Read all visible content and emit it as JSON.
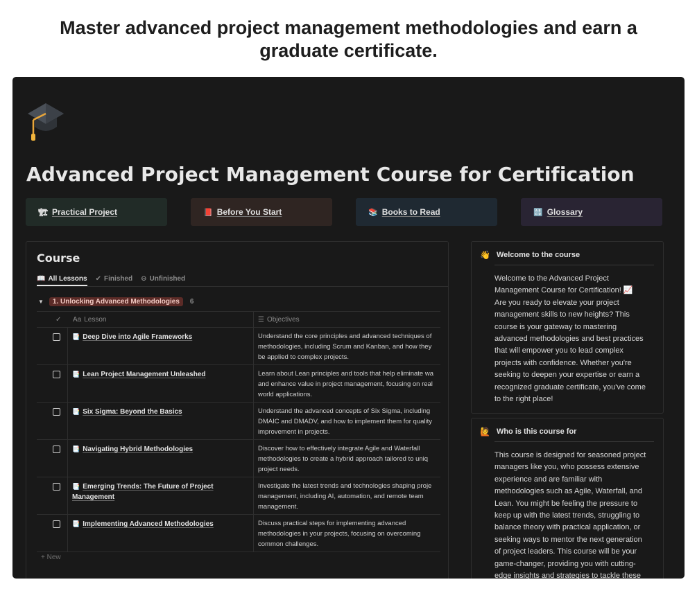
{
  "headline": {
    "line1": "Master advanced project management methodologies and earn a",
    "line2": "graduate certificate."
  },
  "page": {
    "icon": "graduation-cap-icon",
    "title": "Advanced Project Management Course for Certification"
  },
  "links": [
    {
      "icon": "🏗",
      "label": "Practical Project"
    },
    {
      "icon": "📕",
      "label": "Before You Start"
    },
    {
      "icon": "📚",
      "label": "Books to Read"
    },
    {
      "icon": "🔠",
      "label": "Glossary"
    }
  ],
  "course": {
    "title": "Course",
    "tabs": [
      {
        "icon": "📖",
        "label": "All Lessons"
      },
      {
        "icon": "✔",
        "label": "Finished"
      },
      {
        "icon": "⊖",
        "label": "Unfinished"
      }
    ],
    "group": {
      "name": "1. Unlocking Advanced Methodologies",
      "count": "6"
    },
    "columns": {
      "lesson": "Lesson",
      "lesson_icon": "Aa",
      "objectives": "Objectives"
    },
    "rows": [
      {
        "lesson": "Deep Dive into Agile Frameworks",
        "lesson2": "",
        "obj1": "Understand the core principles and advanced techniques of",
        "obj2": "methodologies, including Scrum and Kanban, and how they",
        "obj3": "be applied to complex projects."
      },
      {
        "lesson": "Lean Project Management Unleashed",
        "lesson2": "",
        "obj1": "Learn about Lean principles and tools that help eliminate wa",
        "obj2": "and enhance value in project management, focusing on real",
        "obj3": "world applications."
      },
      {
        "lesson": "Six Sigma: Beyond the Basics",
        "lesson2": "",
        "obj1": "Understand the advanced concepts of Six Sigma, including",
        "obj2": "DMAIC and DMADV, and how to implement them for quality",
        "obj3": "improvement in projects."
      },
      {
        "lesson": "Navigating Hybrid Methodologies",
        "lesson2": "",
        "obj1": "Discover how to effectively integrate Agile and Waterfall",
        "obj2": "methodologies to create a hybrid approach tailored to uniq",
        "obj3": "project needs."
      },
      {
        "lesson": "Emerging Trends: The Future of Project",
        "lesson2": "Management",
        "obj1": "Investigate the latest trends and technologies shaping proje",
        "obj2": "management, including AI, automation, and remote team",
        "obj3": "management."
      },
      {
        "lesson": "Implementing Advanced Methodologies",
        "lesson2": "",
        "obj1": "Discuss practical steps for implementing advanced",
        "obj2": "methodologies in your projects, focusing on overcoming",
        "obj3": "common challenges."
      }
    ],
    "new_label": "+ New"
  },
  "welcome": {
    "icon": "👋",
    "title": "Welcome to the course",
    "lines": [
      "Welcome to the Advanced Project",
      "Management Course for Certification! 📈",
      "Are you ready to elevate your project",
      "management skills to new heights? This",
      "course is your gateway to mastering",
      "advanced methodologies and best practices",
      "that will empower you to lead complex",
      "projects with confidence. Whether you're",
      "seeking to deepen your expertise or earn a",
      "recognized graduate certificate, you've come",
      "to the right place!"
    ]
  },
  "who": {
    "icon": "🙋",
    "title": "Who is this course for",
    "lines": [
      "This course is designed for seasoned project",
      "managers like you, who possess extensive",
      "experience and are familiar with",
      "methodologies such as Agile, Waterfall, and",
      "Lean. You might be feeling the pressure to",
      "keep up with the latest trends, struggling to",
      "balance theory with practical application, or",
      "seeking ways to mentor the next generation",
      "of project leaders. This course will be your",
      "game-changer, providing you with cutting-",
      "edge insights and strategies to tackle these"
    ]
  }
}
